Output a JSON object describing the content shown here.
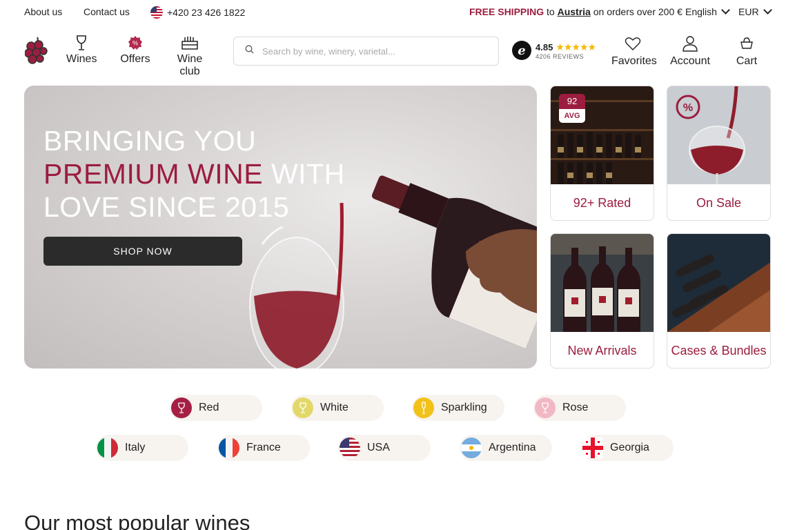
{
  "topbar": {
    "about": "About us",
    "contact": "Contact us",
    "phone": "+420 23 426 1822",
    "shipping_free": "FREE SHIPPING",
    "shipping_to": "to",
    "shipping_country": "Austria",
    "shipping_rest": "on orders over 200 €",
    "language": "English",
    "currency": "EUR"
  },
  "nav": {
    "wines": "Wines",
    "offers": "Offers",
    "wine_club": "Wine club"
  },
  "search": {
    "placeholder": "Search by wine, winery, varietal..."
  },
  "rating": {
    "score": "4.85",
    "stars": "★★★★★",
    "reviews": "4206 REVIEWS",
    "badge": "e"
  },
  "header_actions": {
    "favorites": "Favorites",
    "account": "Account",
    "cart": "Cart"
  },
  "hero": {
    "line1": "BRINGING YOU",
    "line2_accent": "PREMIUM WINE",
    "line2_rest": " WITH",
    "line3": "LOVE SINCE 2015",
    "cta": "SHOP NOW"
  },
  "tiles": {
    "rated": {
      "label": "92+ Rated",
      "badge_num": "92",
      "badge_text": "AVG"
    },
    "sale": {
      "label": "On Sale",
      "badge_text": "%"
    },
    "new": {
      "label": "New Arrivals"
    },
    "cases": {
      "label": "Cases & Bundles"
    }
  },
  "wine_types": [
    "Red",
    "White",
    "Sparkling",
    "Rose"
  ],
  "countries": [
    "Italy",
    "France",
    "USA",
    "Argentina",
    "Georgia"
  ],
  "popular_title": "Our most popular wines",
  "colors": {
    "accent": "#9b1d3f",
    "red_dot": "#a51f45",
    "white_dot": "#e2d86a",
    "sparkling_dot": "#f2c21b",
    "rose_dot": "#f1b8c3"
  }
}
